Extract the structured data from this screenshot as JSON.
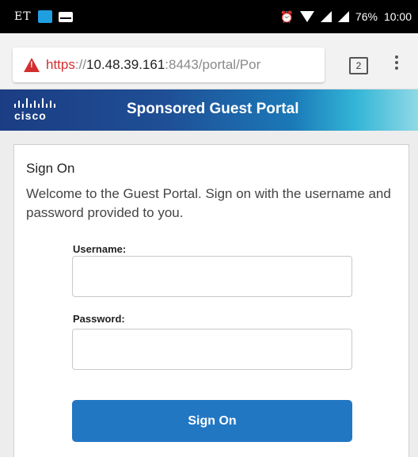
{
  "status_bar": {
    "carrier": "ET",
    "battery": "76%",
    "time": "10:00",
    "icons": [
      "app-icon",
      "mail-icon",
      "alarm-icon",
      "wifi-icon",
      "signal-icon",
      "signal-icon"
    ]
  },
  "browser": {
    "url_scheme": "https",
    "url_separator": "://",
    "url_host": "10.48.39.161",
    "url_rest": ":8443/portal/Por",
    "tab_count": "2",
    "colors": {
      "warning": "#d32f2f"
    }
  },
  "banner": {
    "logo_text": "cisco",
    "title": "Sponsored Guest Portal"
  },
  "signon": {
    "title": "Sign On",
    "message": "Welcome to the Guest Portal. Sign on with the username and password provided to you.",
    "username_label": "Username:",
    "username_value": "",
    "password_label": "Password:",
    "password_value": "",
    "button_label": "Sign On",
    "colors": {
      "button": "#2277c3"
    }
  }
}
